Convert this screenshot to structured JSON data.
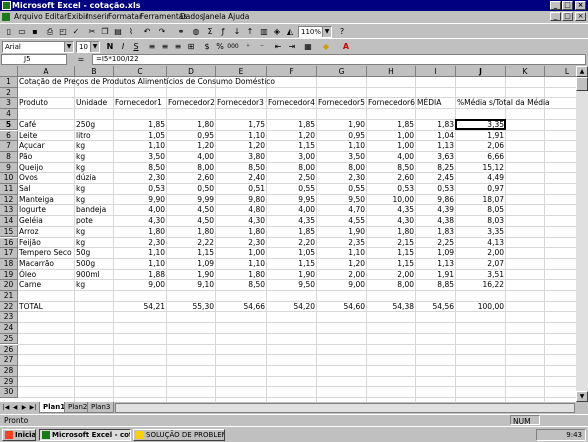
{
  "window": {
    "title": "Microsoft Excel - cotação.xls"
  },
  "menu": [
    "Arquivo",
    "Editar",
    "Exibir",
    "Inserir",
    "Formatar",
    "Ferramentas",
    "Dados",
    "Janela",
    "Ajuda"
  ],
  "toolbar": {
    "zoom": "110%",
    "font": "Arial",
    "size": "10"
  },
  "formula": {
    "name_box": "J5",
    "content": "=I5*100/I22"
  },
  "columns": [
    "A",
    "B",
    "C",
    "D",
    "E",
    "F",
    "G",
    "H",
    "I",
    "J",
    "K",
    "L"
  ],
  "rows": [
    "1",
    "2",
    "3",
    "4",
    "5",
    "6",
    "7",
    "8",
    "9",
    "10",
    "11",
    "12",
    "13",
    "14",
    "15",
    "16",
    "17",
    "18",
    "19",
    "20",
    "21",
    "22",
    "23",
    "24",
    "25",
    "26",
    "27",
    "28",
    "29",
    "30"
  ],
  "sheet": {
    "title": "Cotação de Preços de Produtos Alimentícios de Consumo Doméstico",
    "headers": [
      "Produto",
      "Unidade",
      "Fornecedor1",
      "Fornecedor2",
      "Fornecedor3",
      "Fornecedor4",
      "Fornecedor5",
      "Fornecedor6",
      "MÉDIA",
      "%Média s/Total da Média"
    ],
    "data": [
      [
        "Café",
        "250g",
        "1,85",
        "1,80",
        "1,75",
        "1,85",
        "1,90",
        "1,85",
        "1,83",
        "3,35"
      ],
      [
        "Leite",
        "litro",
        "1,05",
        "0,95",
        "1,10",
        "1,20",
        "0,95",
        "1,00",
        "1,04",
        "1,91"
      ],
      [
        "Açucar",
        "kg",
        "1,10",
        "1,20",
        "1,20",
        "1,15",
        "1,10",
        "1,00",
        "1,13",
        "2,06"
      ],
      [
        "Pão",
        "kg",
        "3,50",
        "4,00",
        "3,80",
        "3,00",
        "3,50",
        "4,00",
        "3,63",
        "6,66"
      ],
      [
        "Queijo",
        "kg",
        "8,50",
        "8,00",
        "8,50",
        "8,00",
        "8,00",
        "8,50",
        "8,25",
        "15,12"
      ],
      [
        "Ovos",
        "dúzia",
        "2,30",
        "2,60",
        "2,40",
        "2,50",
        "2,30",
        "2,60",
        "2,45",
        "4,49"
      ],
      [
        "Sal",
        "kg",
        "0,53",
        "0,50",
        "0,51",
        "0,55",
        "0,55",
        "0,53",
        "0,53",
        "0,97"
      ],
      [
        "Manteiga",
        "kg",
        "9,90",
        "9,99",
        "9,80",
        "9,95",
        "9,50",
        "10,00",
        "9,86",
        "18,07"
      ],
      [
        "Iogurte",
        "bandeja",
        "4,00",
        "4,50",
        "4,80",
        "4,00",
        "4,70",
        "4,35",
        "4,39",
        "8,05"
      ],
      [
        "Geléia",
        "pote",
        "4,30",
        "4,50",
        "4,30",
        "4,35",
        "4,55",
        "4,30",
        "4,38",
        "8,03"
      ],
      [
        "Arroz",
        "kg",
        "1,80",
        "1,80",
        "1,80",
        "1,85",
        "1,90",
        "1,80",
        "1,83",
        "3,35"
      ],
      [
        "Feijão",
        "kg",
        "2,30",
        "2,22",
        "2,30",
        "2,20",
        "2,35",
        "2,15",
        "2,25",
        "4,13"
      ],
      [
        "Tempero Seco",
        "50g",
        "1,10",
        "1,15",
        "1,00",
        "1,05",
        "1,10",
        "1,15",
        "1,09",
        "2,00"
      ],
      [
        "Macarrão",
        "500g",
        "1,10",
        "1,09",
        "1,10",
        "1,15",
        "1,20",
        "1,15",
        "1,13",
        "2,07"
      ],
      [
        "Óleo",
        "900ml",
        "1,88",
        "1,90",
        "1,80",
        "1,90",
        "2,00",
        "2,00",
        "1,91",
        "3,51"
      ],
      [
        "Carne",
        "kg",
        "9,00",
        "9,10",
        "8,50",
        "9,50",
        "9,00",
        "8,00",
        "8,85",
        "16,22"
      ]
    ],
    "total_label": "TOTAL",
    "totals": [
      "54,21",
      "55,30",
      "54,66",
      "54,20",
      "54,60",
      "54,38",
      "54,56",
      "100,00"
    ]
  },
  "sheet_tabs": [
    "Plan1",
    "Plan2",
    "Plan3"
  ],
  "status": {
    "left": "Pronto",
    "num": "NUM"
  },
  "taskbar": {
    "start": "Iniciar",
    "excel": "Microsoft Excel - cot...",
    "other": "SOLUÇÃO DE PROBLEM...",
    "clock": "9:43"
  }
}
